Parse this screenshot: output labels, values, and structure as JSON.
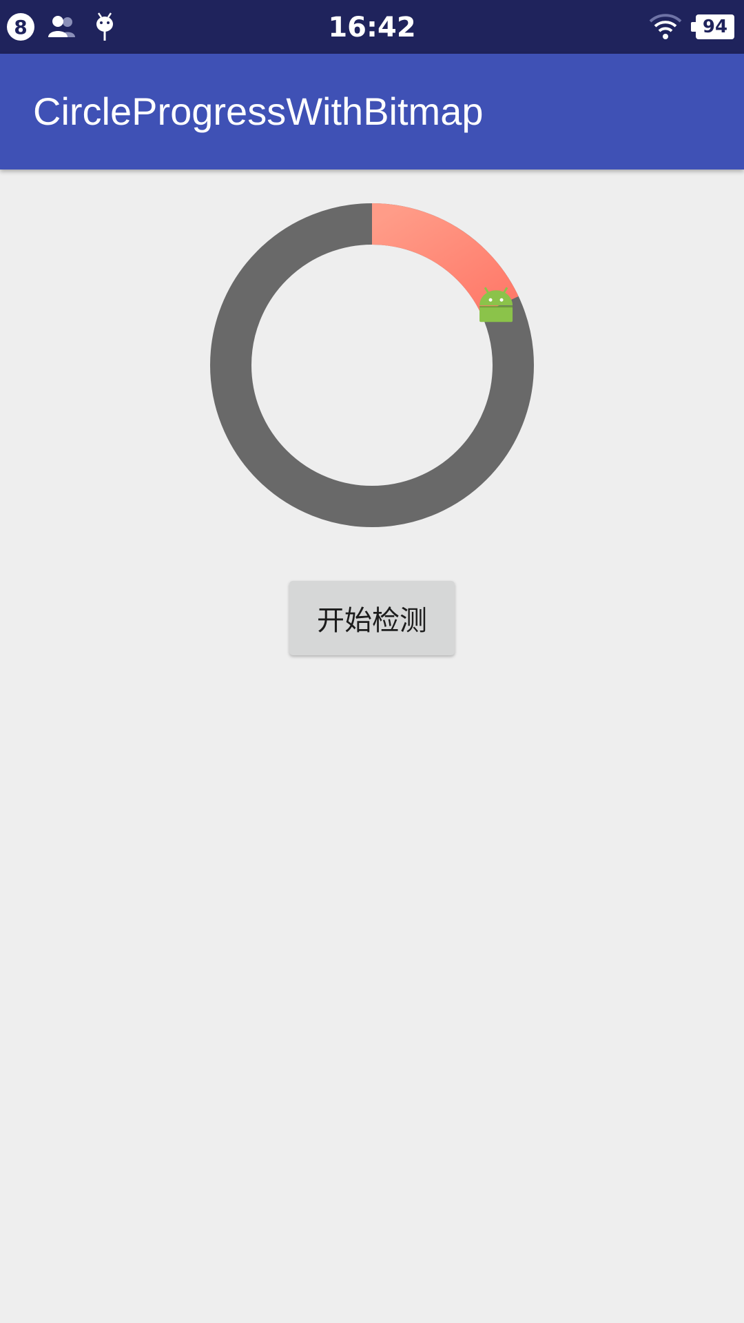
{
  "status_bar": {
    "notification_count": "8",
    "time": "16:42",
    "battery_level": "94",
    "icons": [
      "notification-count-icon",
      "contacts-icon",
      "android-debug-icon",
      "wifi-icon",
      "battery-icon"
    ]
  },
  "app_bar": {
    "title": "CircleProgressWithBitmap",
    "color": "#3f51b5"
  },
  "progress": {
    "value_fraction": 0.18,
    "track_color": "#696969",
    "progress_color_start": "#ff9c88",
    "progress_color_end": "#ff7a6a",
    "indicator_icon": "android-robot-icon"
  },
  "start_button": {
    "label": "开始检测"
  },
  "colors": {
    "status_bar": "#1f235c",
    "background": "#eeeeee"
  }
}
